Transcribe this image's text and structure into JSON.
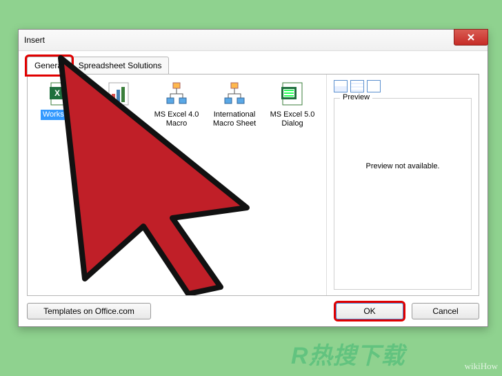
{
  "dialog": {
    "title": "Insert",
    "tabs": [
      {
        "label": "General",
        "active": true,
        "highlight": true
      },
      {
        "label": "Spreadsheet Solutions",
        "active": false,
        "highlight": false
      }
    ],
    "templates": [
      {
        "label": "Worksheet",
        "selected": true,
        "icon": "excel"
      },
      {
        "label": "Chart",
        "selected": false,
        "icon": "chart"
      },
      {
        "label": "MS Excel 4.0 Macro",
        "selected": false,
        "icon": "flow"
      },
      {
        "label": "International Macro Sheet",
        "selected": false,
        "icon": "flow"
      },
      {
        "label": "MS Excel 5.0 Dialog",
        "selected": false,
        "icon": "excel"
      }
    ],
    "preview": {
      "legend": "Preview",
      "message": "Preview not available."
    },
    "buttons": {
      "templates": "Templates on Office.com",
      "ok": "OK",
      "cancel": "Cancel"
    }
  },
  "watermarks": {
    "wiki": "wikiHow",
    "cn_r": "R",
    "cn_text": "热搜下载"
  }
}
